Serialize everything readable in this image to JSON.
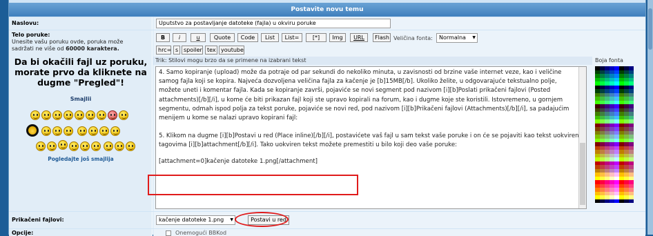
{
  "header": {
    "title": "Postavite novu temu"
  },
  "subject": {
    "label": "Naslovu:",
    "value": "Uputstvo za postavljanje datoteke (fajla) u okviru poruke"
  },
  "body": {
    "label": "Telo poruke:",
    "help_line1": "Unesite vašu poruku ovde, poruka može",
    "help_line2_prefix": "sadržati ne više od",
    "help_line2_bold": "60000 karaktera.",
    "notice": "Da bi okačili fajl uz poruku, morate prvo da kliknete na dugme \"Pregled\"!",
    "smileys_title": "Smajlii",
    "more_smileys": "Pogledajte još smajlija"
  },
  "toolbar": {
    "row1": [
      "B",
      "i",
      "u",
      "Quote",
      "Code",
      "List",
      "List=",
      "[*]",
      "Img",
      "URL",
      "Flash"
    ],
    "font_size_label": "Veličina fonta:",
    "font_size_value": "Normalna",
    "row2": [
      "hrc=",
      "s",
      "spoiler",
      "tex",
      "youtube"
    ],
    "tip": "Trik: Stilovi mogu brzo da se primene na izabrani tekst",
    "colors_label": "Boja fonta"
  },
  "message": {
    "para1": "4. Samo kopiranje (upload) može da potraje od par sekundi do nekoliko minuta, u zavisnosti od brzine vaše internet veze, kao i veličine samog fajla koji se kopira. Najveća dozvoljena veličina fajla za kačenje je [b]15MB[/b]. Ukoliko želite, u odgovarajuće tekstualno polje, možete uneti i komentar fajla. Kada se kopiranje završi, pojaviće se novi segment pod nazivom [i][b]Poslati prikačeni fajlovi (Posted attachments)[/b][/i], u kome će biti prikazan fajl koji ste upravo kopirali na forum, kao i dugme koje ste koristili. Istovremeno, u gornjem segmentu, odmah ispod polja za tekst poruke, pojaviće se novi red, pod nazivom [i][b]Prikačeni fajlovi (Attachments)[/b][/i], sa padajućim menijem u kome se nalazi upravo kopirani fajl:",
    "para2": "5. Klikom na dugme [i][b]Postavi u red (Place inline)[/b][/i], postavićete vaš fajl u sam tekst vaše poruke i on će se pojaviti kao tekst uokviren tagovima [i][b]attachment[/b][/i]. Tako uokviren tekst možete premestiti u bilo koji deo vaše poruke:",
    "attachment_tag": "[attachment=0]kačenje datoteke 1.png[/attachment]"
  },
  "attachments": {
    "label": "Prikačeni fajlovi:",
    "selected": "kačenje datoteke 1.png",
    "place_inline": "Postavi u red"
  },
  "options": {
    "label": "Opcije:",
    "first": "Onemogući BBKod"
  }
}
